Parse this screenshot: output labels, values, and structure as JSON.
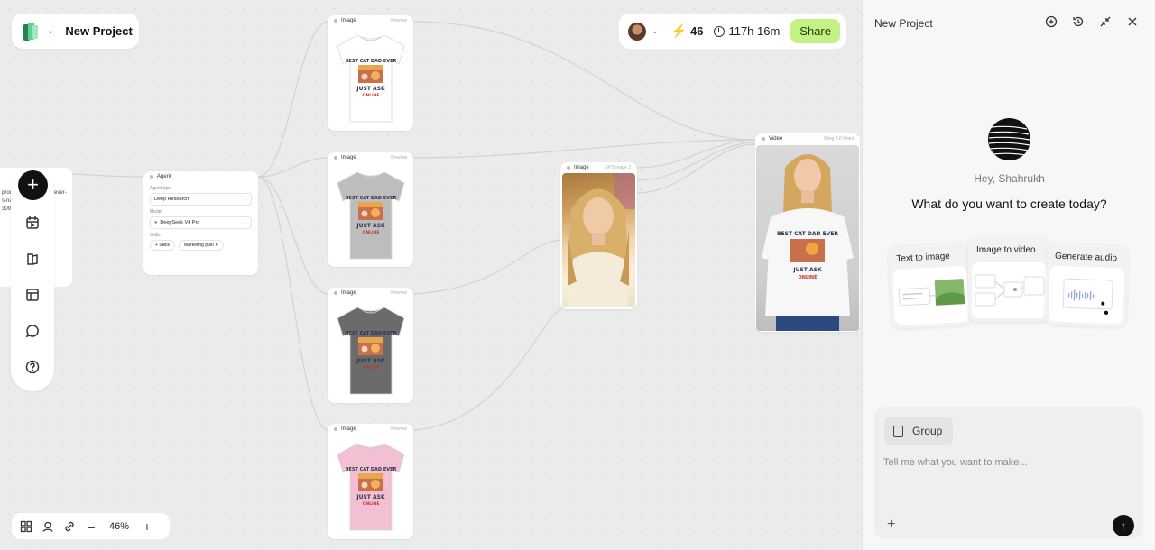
{
  "project": {
    "name": "New Project"
  },
  "topbar": {
    "credits": "46",
    "time_left": "117h 16m",
    "share_label": "Share"
  },
  "partial_node": {
    "lines": [
      "prod",
      "s-na",
      "309€"
    ],
    "tail": "ever-"
  },
  "agent_node": {
    "title": "Agent",
    "agent_type_label": "Agent type",
    "agent_type_value": "Deep Research",
    "model_label": "Model",
    "model_value": "DeepSeek V4 Pro",
    "skills_label": "Skills",
    "skills_add": "+ Skills",
    "skill_chip": "Marketing plan"
  },
  "image_nodes": [
    {
      "title": "Image",
      "action": "Preview",
      "shirt_color": "#ffffff"
    },
    {
      "title": "Image",
      "action": "Preview",
      "shirt_color": "#bdbdbd"
    },
    {
      "title": "Image",
      "action": "Preview",
      "shirt_color": "#6b6b6b"
    },
    {
      "title": "Image",
      "action": "Preview",
      "shirt_color": "#f3bfd2"
    }
  ],
  "shirt_print": {
    "line1": "BEST CAT DAD EVER",
    "line2": "JUST ASK",
    "line3": "ONLINE"
  },
  "photo_node": {
    "title": "Image",
    "model": "GPT image 2"
  },
  "video_node": {
    "title": "Video",
    "model": "Kling 3.0 Omni"
  },
  "zoom": {
    "level": "46%",
    "minus": "–",
    "plus": "+"
  },
  "panel": {
    "title": "New Project",
    "greeting": "Hey, Shahrukh",
    "question": "What do you want to create today?",
    "cards": [
      {
        "title": "Text to image"
      },
      {
        "title": "Image to video"
      },
      {
        "title": "Generate audio"
      }
    ],
    "composer": {
      "group_label": "Group",
      "placeholder": "Tell me what you want to make..."
    }
  },
  "colors": {
    "accent_share": "#c4f184",
    "send_button": "#111111"
  }
}
